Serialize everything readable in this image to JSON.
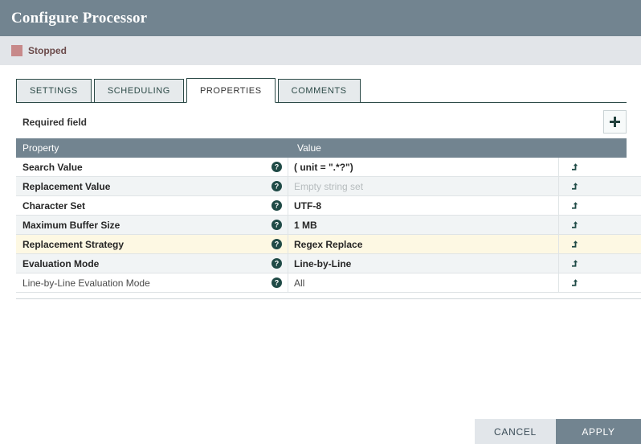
{
  "window": {
    "title": "Configure Processor"
  },
  "status": {
    "label": "Stopped",
    "color": "#c7898a"
  },
  "tabs": [
    {
      "label": "SETTINGS",
      "active": false
    },
    {
      "label": "SCHEDULING",
      "active": false
    },
    {
      "label": "PROPERTIES",
      "active": true
    },
    {
      "label": "COMMENTS",
      "active": false
    }
  ],
  "toolbar": {
    "required_field_label": "Required field",
    "add_icon": "plus-icon",
    "add_title": "Add property"
  },
  "table": {
    "columns": [
      "Property",
      "Value"
    ],
    "help_icon": "help-circle-icon",
    "action_icon": "goto-arrow-icon",
    "rows": [
      {
        "property": "Search Value",
        "value": "( unit = \".*?\")",
        "required": true,
        "placeholder": false,
        "highlight": false
      },
      {
        "property": "Replacement Value",
        "value": "Empty string set",
        "required": true,
        "placeholder": true,
        "highlight": false
      },
      {
        "property": "Character Set",
        "value": "UTF-8",
        "required": true,
        "placeholder": false,
        "highlight": false
      },
      {
        "property": "Maximum Buffer Size",
        "value": "1 MB",
        "required": true,
        "placeholder": false,
        "highlight": false
      },
      {
        "property": "Replacement Strategy",
        "value": "Regex Replace",
        "required": true,
        "placeholder": false,
        "highlight": true
      },
      {
        "property": "Evaluation Mode",
        "value": "Line-by-Line",
        "required": true,
        "placeholder": false,
        "highlight": false
      },
      {
        "property": "Line-by-Line Evaluation Mode",
        "value": "All",
        "required": false,
        "placeholder": false,
        "highlight": false
      }
    ]
  },
  "footer": {
    "cancel_label": "CANCEL",
    "apply_label": "APPLY"
  },
  "colors": {
    "titlebar": "#728490",
    "statusbar": "#e2e5e9",
    "accent": "#2c4a47",
    "highlight_row": "#fdf8e3",
    "apply_button": "#728490"
  }
}
